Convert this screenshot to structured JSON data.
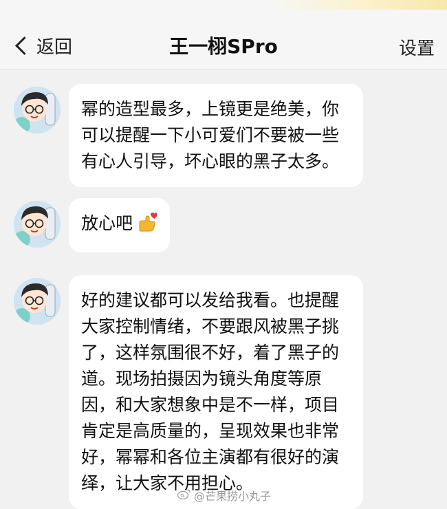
{
  "header": {
    "back_label": "返回",
    "title": "王一栩SPro",
    "settings_label": "设置"
  },
  "messages": [
    {
      "text": "幂的造型最多，上镜更是绝美，你可以提醒一下小可爱们不要被一些有心人引导，坏心眼的黑子太多。"
    },
    {
      "text": "放心吧",
      "emoji": "hand-with-heart-emoji"
    },
    {
      "text": "好的建议都可以发给我看。也提醒大家控制情绪，不要跟风被黑子挑了，这样氛围很不好，着了黑子的道。现场拍摄因为镜头角度等原因，和大家想象中是不一样，项目肯定是高质量的，呈现效果也非常好，幂幂和各位主演都有很好的演绎，让大家不用担心。"
    }
  ],
  "watermark": {
    "text": "@芒果捞小丸子",
    "icon": "weibo-icon"
  }
}
